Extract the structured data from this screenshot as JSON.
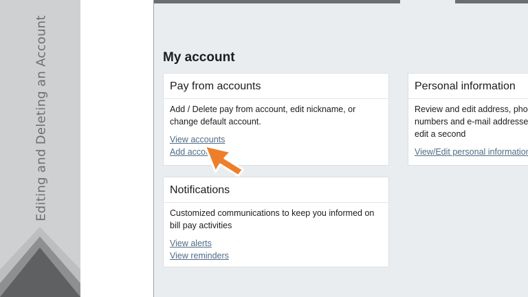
{
  "banner": {
    "title": "Editing and Deleting an Account"
  },
  "page": {
    "title": "My account"
  },
  "cards": {
    "pay": {
      "title": "Pay from accounts",
      "description": "Add / Delete pay from account, edit nickname, or change default account.",
      "links": [
        "View accounts",
        "Add account"
      ]
    },
    "personal": {
      "title": "Personal information",
      "description": "Review and edit address, phone numbers and e-mail addresses. Add or edit a second",
      "links": [
        "View/Edit personal information"
      ]
    },
    "notifications": {
      "title": "Notifications",
      "description": "Customized communications to keep you informed on bill pay activities",
      "links": [
        "View alerts",
        "View reminders"
      ]
    }
  },
  "colors": {
    "pointer": "#ee7f2a",
    "link": "#4e6b86",
    "banner": "#cfd0d2"
  },
  "icons": {
    "pointer": "arrow-pointer-icon"
  }
}
